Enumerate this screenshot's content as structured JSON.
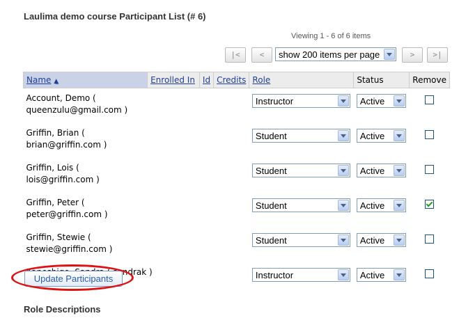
{
  "page": {
    "title": "Laulima demo course Participant List (# 6)",
    "viewing": "Viewing 1 - 6 of 6 items",
    "role_descriptions_heading": "Role Descriptions"
  },
  "pager": {
    "first": "|<",
    "prev": "<",
    "next": ">",
    "last": ">|",
    "per_page": "show 200 items per page"
  },
  "table": {
    "headers": {
      "name": "Name",
      "enrolled_in": "Enrolled In",
      "id": "Id",
      "credits": "Credits",
      "role": "Role",
      "status": "Status",
      "remove": "Remove"
    },
    "rows": [
      {
        "name_line1": "Account, Demo (",
        "name_line2": "queenzulu@gmail.com )",
        "role": "Instructor",
        "status": "Active",
        "remove": false
      },
      {
        "name_line1": "Griffin, Brian (",
        "name_line2": "brian@griffin.com )",
        "role": "Student",
        "status": "Active",
        "remove": false
      },
      {
        "name_line1": "Griffin, Lois (",
        "name_line2": "lois@griffin.com )",
        "role": "Student",
        "status": "Active",
        "remove": false
      },
      {
        "name_line1": "Griffin, Peter (",
        "name_line2": "peter@griffin.com )",
        "role": "Student",
        "status": "Active",
        "remove": true
      },
      {
        "name_line1": "Griffin, Stewie (",
        "name_line2": "stewie@griffin.com )",
        "role": "Student",
        "status": "Active",
        "remove": false
      },
      {
        "name_line1": "Kaneshige, Sandra ( sandrak )",
        "name_line2": "",
        "role": "Instructor",
        "status": "Active",
        "remove": false
      }
    ]
  },
  "actions": {
    "update_label": "Update Participants"
  },
  "colors": {
    "highlight_circle": "#e01010",
    "link": "#1f3d99",
    "sorted_header_bg": "#c9d2e6"
  }
}
